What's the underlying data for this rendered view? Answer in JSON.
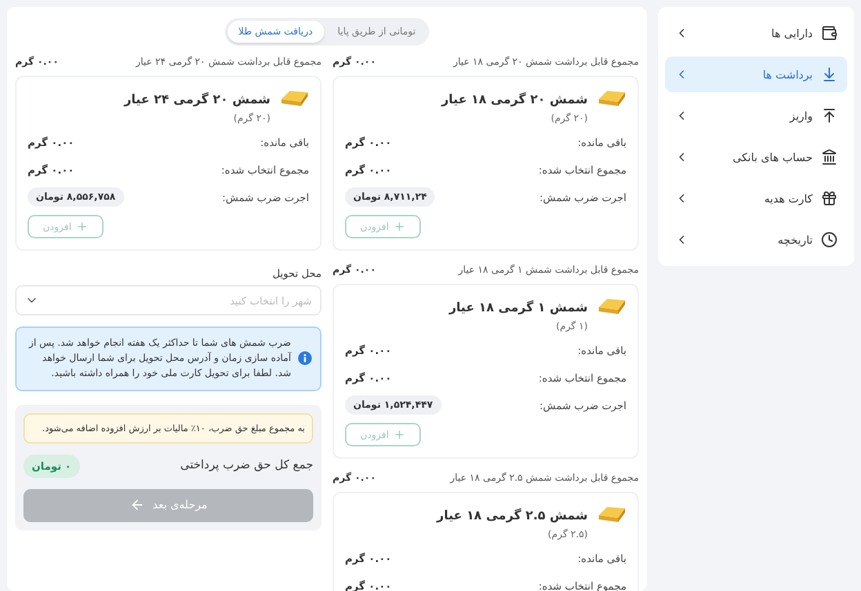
{
  "sidebar": {
    "items": [
      {
        "kind": "wallet",
        "label": "دارایی ها",
        "selected": false
      },
      {
        "kind": "withdraw",
        "label": "برداشت ها",
        "selected": true
      },
      {
        "kind": "deposit",
        "label": "واریز",
        "selected": false
      },
      {
        "kind": "bank",
        "label": "حساب های بانکی",
        "selected": false
      },
      {
        "kind": "gift",
        "label": "کارت هدیه",
        "selected": false
      },
      {
        "kind": "history",
        "label": "تاریخچه",
        "selected": false
      }
    ]
  },
  "tabs": [
    {
      "label": "تومانی از طریق پایا",
      "selected": false
    },
    {
      "label": "دریافت شمش طلا",
      "selected": true
    }
  ],
  "right_column": {
    "groups": [
      {
        "total_label": "مجموع قابل برداشت شمش ۲۰ گرمی ۱۸ عیار",
        "total_value": "۰.۰۰ گرم",
        "title": "شمش ۲۰ گرمی ۱۸ عیار",
        "weight": "(۲۰ گرم)",
        "rows": [
          {
            "kind": "text",
            "label": "باقی مانده:",
            "value": "۰.۰۰ گرم"
          },
          {
            "kind": "text",
            "label": "مجموع انتخاب شده:",
            "value": "۰.۰۰ گرم"
          },
          {
            "kind": "pill",
            "label": "اجرت ضرب شمش:",
            "value": "۸,۷۱۱,۲۴ تومان"
          }
        ],
        "add": {
          "label": "افزودن",
          "disabled": true
        }
      },
      {
        "total_label": "مجموع قابل برداشت شمش ۱ گرمی ۱۸ عیار",
        "total_value": "۰.۰۰ گرم",
        "title": "شمش ۱ گرمی ۱۸ عیار",
        "weight": "(۱ گرم)",
        "rows": [
          {
            "kind": "text",
            "label": "باقی مانده:",
            "value": "۰.۰۰ گرم"
          },
          {
            "kind": "text",
            "label": "مجموع انتخاب شده:",
            "value": "۰.۰۰ گرم"
          },
          {
            "kind": "pill",
            "label": "اجرت ضرب شمش:",
            "value": "۱,۵۲۴,۴۴۷ تومان"
          }
        ],
        "add": {
          "label": "افزودن",
          "disabled": true
        }
      },
      {
        "total_label": "مجموع قابل برداشت شمش ۲.۵ گرمی ۱۸ عیار",
        "total_value": "۰.۰۰ گرم",
        "title": "شمش ۲.۵ گرمی ۱۸ عیار",
        "weight": "(۲.۵ گرم)",
        "rows": [
          {
            "kind": "text",
            "label": "باقی مانده:",
            "value": "۰.۰۰ گرم"
          },
          {
            "kind": "text",
            "label": "مجموع انتخاب شده:",
            "value": "۰.۰۰ گرم"
          }
        ]
      }
    ]
  },
  "left_column": {
    "groups": [
      {
        "total_label": "مجموع قابل برداشت شمش ۲۰ گرمی ۲۴ عیار",
        "total_value": "۰.۰۰ گرم",
        "title": "شمش ۲۰ گرمی ۲۴ عیار",
        "weight": "(۲۰ گرم)",
        "rows": [
          {
            "kind": "text",
            "label": "باقی مانده:",
            "value": "۰.۰۰ گرم"
          },
          {
            "kind": "text",
            "label": "مجموع انتخاب شده:",
            "value": "۰.۰۰ گرم"
          },
          {
            "kind": "pill",
            "label": "اجرت ضرب شمش:",
            "value": "۸,۵۵۶,۷۵۸ تومان"
          }
        ],
        "add": {
          "label": "افزودن",
          "disabled": true
        }
      }
    ],
    "delivery": {
      "label": "محل تحویل",
      "placeholder": "شهر را انتخاب کنید"
    },
    "notice": "ضرب شمش های شما تا حداکثر یک هفته انجام خواهد شد. پس از آماده سازی زمان و آدرس محل تحویل برای شما ارسال خواهد شد. لطفا برای تحویل کارت ملی خود را همراه داشته باشید.",
    "summary": {
      "tax_note": "به مجموع مبلغ حق ضرب، ۱۰٪ مالیات بر ارزش افزوده اضافه می‌شود.",
      "total_label": "جمع کل حق ضرب پرداختی",
      "total_value": "۰ تومان",
      "next": {
        "label": "مرحله‌ی بعد",
        "disabled": true
      }
    }
  }
}
